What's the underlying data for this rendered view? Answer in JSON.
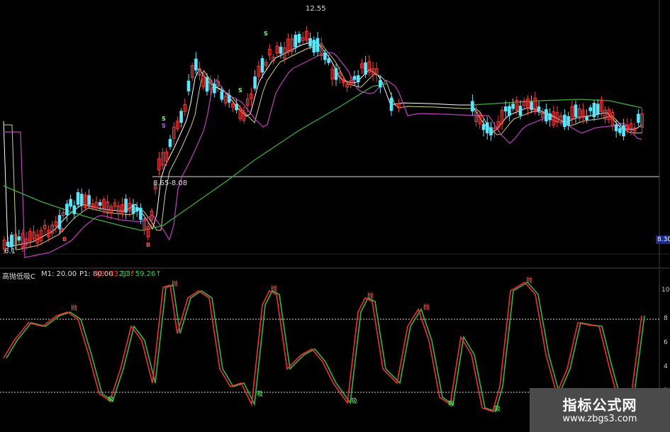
{
  "price_panel": {
    "annotations": {
      "high_label": "12.55",
      "low_range_label": "8.65-8.08",
      "start_label": "6.1",
      "right_axis_label": "8.30"
    },
    "signal_letters": [
      "S",
      "B",
      "S",
      "B",
      "S",
      "B",
      "S"
    ]
  },
  "indicator_panel": {
    "title": "高抛低吸C",
    "m1": "M1: 20.00",
    "p1": "P1: 80.00",
    "sj": "SJ3: 83.11↑",
    "zj": "ZJ3: 59.26↑",
    "right_axis_ticks": [
      "10",
      "8",
      "6",
      "4",
      "2"
    ],
    "sell_tag": "抛",
    "buy_tag": "吸"
  },
  "watermark": {
    "title": "指标公式网",
    "url": "www.zbgs3.com"
  },
  "colors": {
    "candle_up": "#ff3b3b",
    "candle_down": "#57e8ff",
    "ma_short": "#ffffff",
    "ma_mid": "#d6d27a",
    "ma_long_purple": "#c23fc0",
    "ma_long_green": "#3fae3f",
    "osc_red": "#ff2a2a",
    "osc_green": "#2fb84a"
  }
}
